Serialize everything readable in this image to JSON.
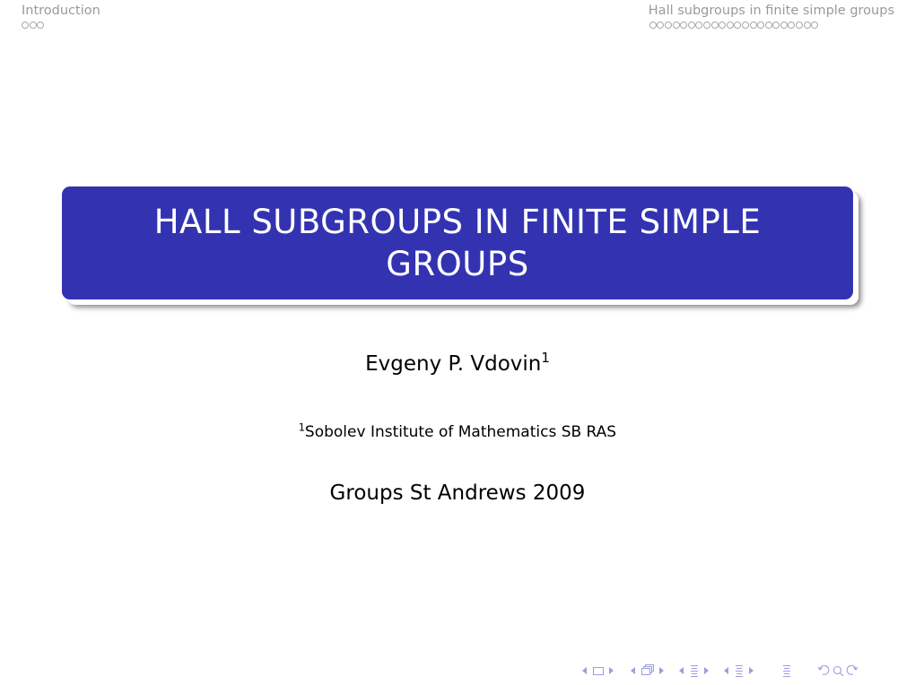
{
  "headline": {
    "left_section": {
      "title": "Introduction",
      "frame_count": 3
    },
    "right_section": {
      "title": "Hall subgroups in finite simple groups",
      "frame_count": 22
    }
  },
  "title_slide": {
    "title": "HALL SUBGROUPS IN FINITE SIMPLE GROUPS",
    "author": "Evgeny P. Vdovin",
    "author_affiliation_mark": "1",
    "institute_mark": "1",
    "institute": "Sobolev Institute of Mathematics SB RAS",
    "date": "Groups St Andrews 2009"
  },
  "colors": {
    "title_box": "#3333b2",
    "title_text": "#ffffff",
    "headline_text": "#9a9a9a",
    "nav_symbols": "#9c9ce0"
  },
  "navigation": {
    "icons": [
      "prev-frame-icon",
      "frame-icon",
      "next-frame-icon",
      "prev-subsection-icon",
      "subsection-icon",
      "next-subsection-icon",
      "prev-section-icon",
      "section-icon",
      "next-section-icon",
      "appendix-icon",
      "back-icon",
      "search-icon",
      "forward-icon"
    ]
  }
}
